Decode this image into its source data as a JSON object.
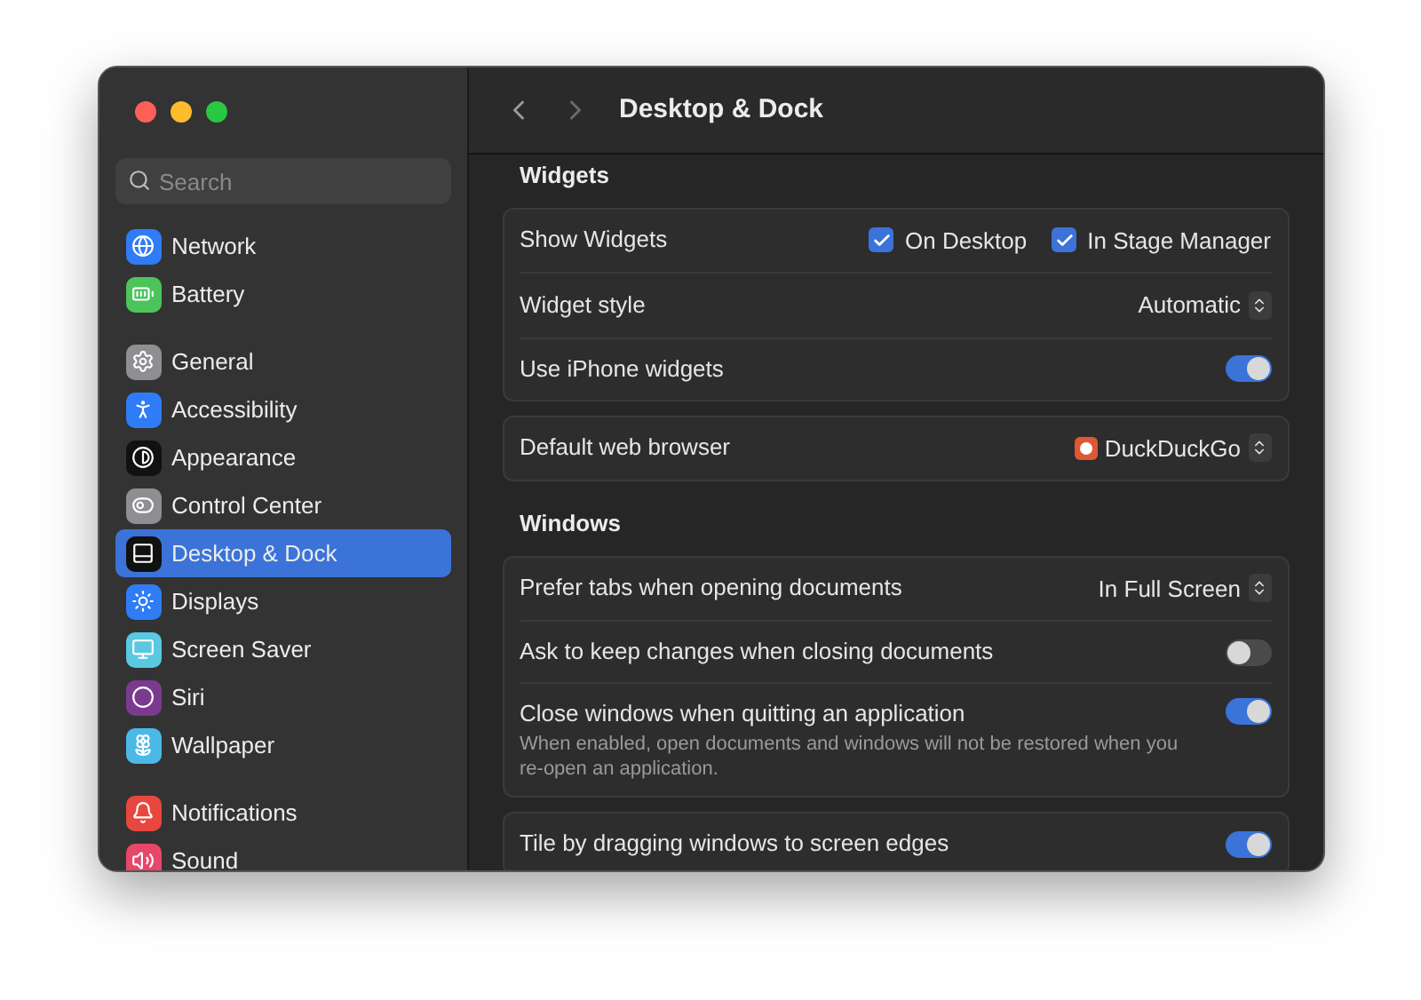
{
  "window": {
    "title": "Desktop & Dock"
  },
  "search": {
    "placeholder": "Search"
  },
  "sidebar": {
    "groups": [
      [
        {
          "label": "Network",
          "color": "#2f7cf6",
          "selected": false
        },
        {
          "label": "Battery",
          "color": "#4cc45a",
          "selected": false
        }
      ],
      [
        {
          "label": "General",
          "color": "#8e8e93",
          "selected": false
        },
        {
          "label": "Accessibility",
          "color": "#2f7cf6",
          "selected": false
        },
        {
          "label": "Appearance",
          "color": "#111111",
          "selected": false
        },
        {
          "label": "Control Center",
          "color": "#8e8e93",
          "selected": false
        },
        {
          "label": "Desktop & Dock",
          "color": "#111111",
          "selected": true
        },
        {
          "label": "Displays",
          "color": "#2f7cf6",
          "selected": false
        },
        {
          "label": "Screen Saver",
          "color": "#5ac8e0",
          "selected": false
        },
        {
          "label": "Siri",
          "color": "#7a3b8f",
          "selected": false
        },
        {
          "label": "Wallpaper",
          "color": "#4cb8e6",
          "selected": false
        }
      ],
      [
        {
          "label": "Notifications",
          "color": "#e8473f",
          "selected": false
        },
        {
          "label": "Sound",
          "color": "#e8476a",
          "selected": false
        }
      ]
    ]
  },
  "sections": [
    {
      "heading": "Widgets",
      "cards": [
        [
          {
            "kind": "checkboxes",
            "label": "Show Widgets",
            "options": [
              {
                "label": "On Desktop",
                "checked": true
              },
              {
                "label": "In Stage Manager",
                "checked": true
              }
            ]
          },
          {
            "kind": "popup",
            "label": "Widget style",
            "value": "Automatic"
          },
          {
            "kind": "toggle",
            "label": "Use iPhone widgets",
            "on": true
          }
        ],
        [
          {
            "kind": "app-popup",
            "label": "Default web browser",
            "value": "DuckDuckGo"
          }
        ]
      ]
    },
    {
      "heading": "Windows",
      "cards": [
        [
          {
            "kind": "popup",
            "label": "Prefer tabs when opening documents",
            "value": "In Full Screen"
          },
          {
            "kind": "toggle",
            "label": "Ask to keep changes when closing documents",
            "on": false
          },
          {
            "kind": "toggle",
            "label": "Close windows when quitting an application",
            "on": true,
            "description": "When enabled, open documents and windows will not be restored when you re-open an application."
          }
        ],
        [
          {
            "kind": "toggle",
            "label": "Tile by dragging windows to screen edges",
            "on": true
          }
        ]
      ]
    }
  ]
}
